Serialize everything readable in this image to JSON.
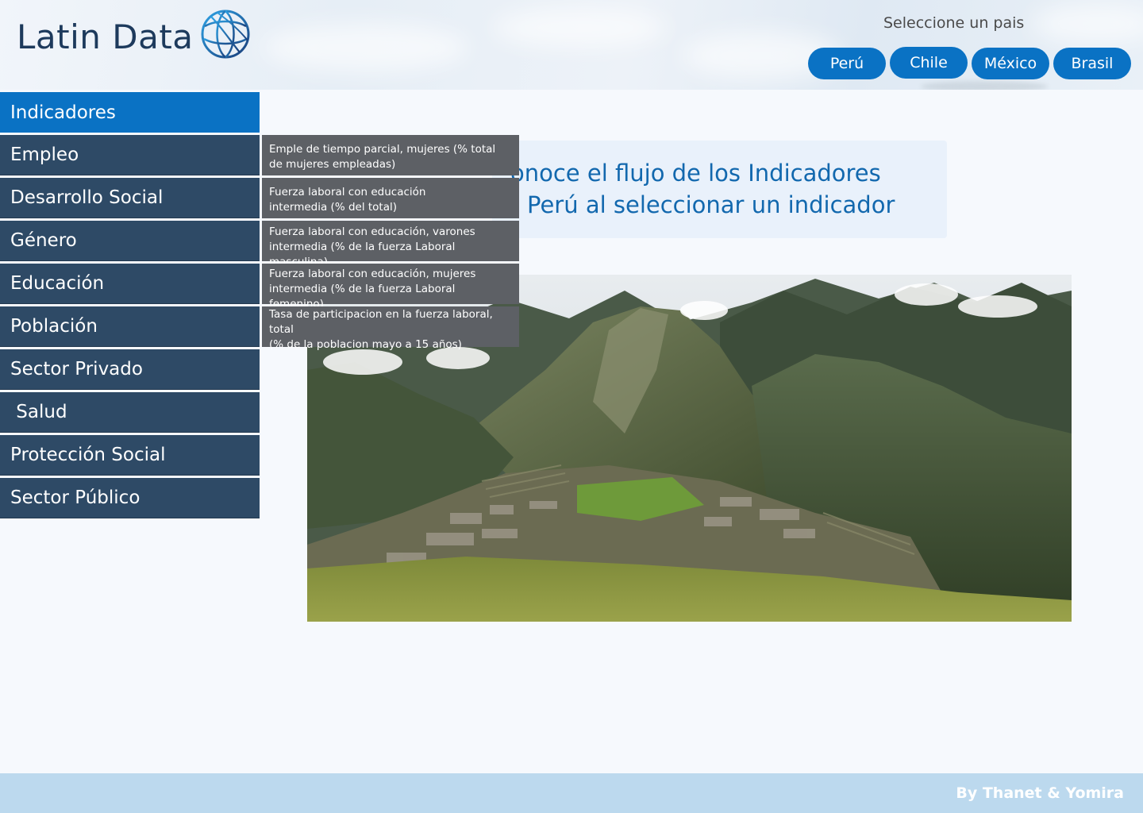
{
  "header": {
    "brand": "Latin Data",
    "country_label": "Seleccione un pais",
    "countries": [
      "Perú",
      "Chile",
      "México",
      "Brasil"
    ]
  },
  "sidebar": {
    "items": [
      {
        "label": "Indicadores"
      },
      {
        "label": "Empleo"
      },
      {
        "label": "Desarrollo Social"
      },
      {
        "label": "Género"
      },
      {
        "label": "Educación"
      },
      {
        "label": "Población"
      },
      {
        "label": "Sector Privado"
      },
      {
        "label": " Salud"
      },
      {
        "label": "Protección Social"
      },
      {
        "label": "Sector Público"
      }
    ]
  },
  "submenu": {
    "items": [
      {
        "line1": "Emple de tiempo parcial, mujeres (% total",
        "line2": "de mujeres empleadas)"
      },
      {
        "line1": "Fuerza laboral con educación",
        "line2": "intermedia (% del total)"
      },
      {
        "line1": "Fuerza laboral con educación, varones",
        "line2": "intermedia (% de la fuerza Laboral masculina)"
      },
      {
        "line1": "Fuerza laboral con educación, mujeres",
        "line2": "intermedia (% de la fuerza Laboral femenino)"
      },
      {
        "line1": "Tasa de participacion en la fuerza laboral, total",
        "line2": "(% de la poblacion mayo a 15 años)"
      }
    ]
  },
  "main": {
    "notice_line1": "onoce el flujo de los Indicadores",
    "notice_line2": "Perú al seleccionar un indicador"
  },
  "footer": {
    "credit": "By Thanet & Yomira"
  },
  "colors": {
    "accent": "#0a72c4",
    "sidebar": "#2e4a66",
    "submenu": "#5d6065",
    "notice_text": "#1268ae",
    "footer": "#bcd9ee"
  },
  "icons": {
    "logo": "world-bank-globe-icon"
  }
}
